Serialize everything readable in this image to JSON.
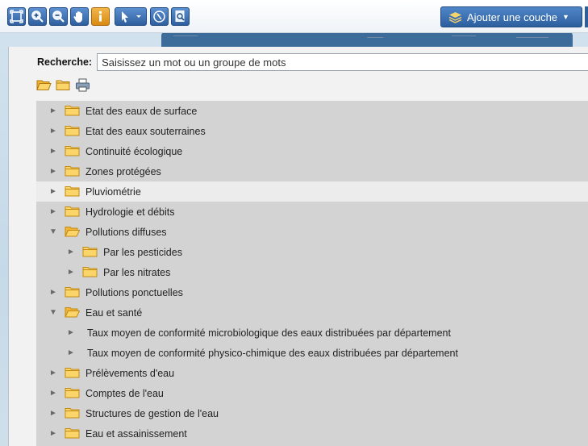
{
  "toolbar": {
    "buttons": [
      {
        "name": "zoom-extent",
        "icon": "zoom-extent-icon"
      },
      {
        "name": "zoom-in",
        "icon": "zoom-in-icon"
      },
      {
        "name": "zoom-out",
        "icon": "zoom-out-icon"
      },
      {
        "name": "pan",
        "icon": "hand-icon"
      },
      {
        "name": "info",
        "icon": "info-icon"
      },
      {
        "name": "select",
        "icon": "cursor-icon"
      },
      {
        "name": "navigate",
        "icon": "compass-icon"
      },
      {
        "name": "query",
        "icon": "document-search-icon"
      }
    ],
    "add_layer_label": "Ajouter une couche"
  },
  "search": {
    "label": "Recherche:",
    "placeholder": "Saisissez un mot ou un groupe de mots"
  },
  "tree": {
    "items": [
      {
        "label": "Etat des eaux de surface",
        "level": 0,
        "type": "folder",
        "expanded": false
      },
      {
        "label": "Etat des eaux souterraines",
        "level": 0,
        "type": "folder",
        "expanded": false
      },
      {
        "label": "Continuité écologique",
        "level": 0,
        "type": "folder",
        "expanded": false
      },
      {
        "label": "Zones protégées",
        "level": 0,
        "type": "folder",
        "expanded": false
      },
      {
        "label": "Pluviométrie",
        "level": 0,
        "type": "folder",
        "expanded": false,
        "highlighted": true
      },
      {
        "label": "Hydrologie et débits",
        "level": 0,
        "type": "folder",
        "expanded": false
      },
      {
        "label": "Pollutions diffuses",
        "level": 0,
        "type": "folder",
        "expanded": true
      },
      {
        "label": "Par les pesticides",
        "level": 1,
        "type": "folder",
        "expanded": false
      },
      {
        "label": "Par les nitrates",
        "level": 1,
        "type": "folder",
        "expanded": false
      },
      {
        "label": "Pollutions ponctuelles",
        "level": 0,
        "type": "folder",
        "expanded": false
      },
      {
        "label": "Eau et santé",
        "level": 0,
        "type": "folder",
        "expanded": true
      },
      {
        "label": "Taux moyen de conformité microbiologique des eaux distribuées par département",
        "level": 1,
        "type": "leaf"
      },
      {
        "label": "Taux moyen de conformité physico-chimique des eaux distribuées par département",
        "level": 1,
        "type": "leaf"
      },
      {
        "label": "Prélèvements d'eau",
        "level": 0,
        "type": "folder",
        "expanded": false
      },
      {
        "label": "Comptes de l'eau",
        "level": 0,
        "type": "folder",
        "expanded": false
      },
      {
        "label": "Structures de gestion de l'eau",
        "level": 0,
        "type": "folder",
        "expanded": false
      },
      {
        "label": "Eau et assainissement",
        "level": 0,
        "type": "folder",
        "expanded": false
      }
    ]
  },
  "colors": {
    "accent": "#2f5f9f",
    "folder": "#f5c84a",
    "tree_bg": "#d3d3d3",
    "highlight": "#ececec"
  }
}
